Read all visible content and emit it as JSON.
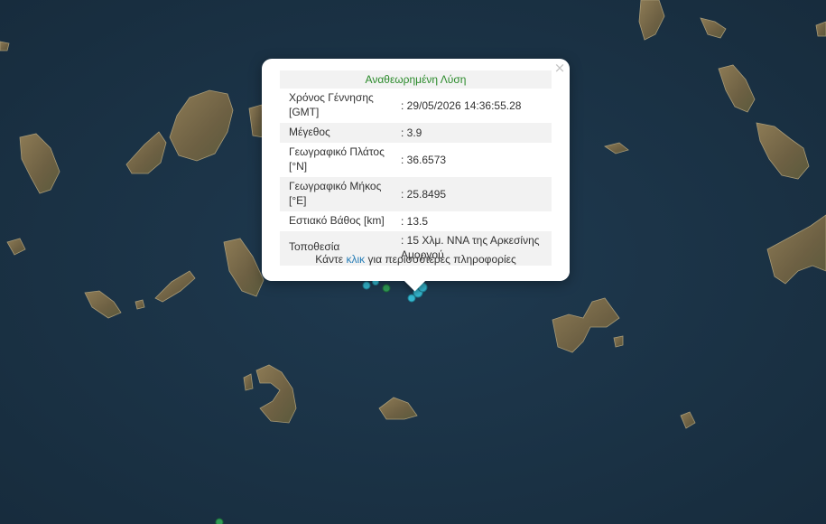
{
  "popup": {
    "title": "Αναθεωρημένη Λύση",
    "close_icon": "close-icon",
    "rows": [
      {
        "label": "Χρόνος Γέννησης [GMT]",
        "value": ": 29/05/2026 14:36:55.28"
      },
      {
        "label": "Μέγεθος",
        "value": ": 3.9"
      },
      {
        "label": "Γεωγραφικό Πλάτος [°N]",
        "value": ": 36.6573"
      },
      {
        "label": "Γεωγραφικό Μήκος [°E]",
        "value": ": 25.8495"
      },
      {
        "label": "Εστιακό Βάθος [km]",
        "value": ": 13.5"
      },
      {
        "label": "Τοποθεσία",
        "value": ": 15 Χλμ. ΝΝΑ της Αρκεσίνης Αμοργού"
      }
    ],
    "footer_prefix": "Κάντε",
    "footer_link": "κλικ",
    "footer_suffix": "για περισσότερες πληροφορίες"
  },
  "colors": {
    "sea": "#1a3346",
    "land": "#7a6a4a",
    "quake_cyan": "#35b7cf",
    "quake_green": "#2f9a55",
    "title_green": "#2a8a2a",
    "link_blue": "#2a7fb8"
  }
}
